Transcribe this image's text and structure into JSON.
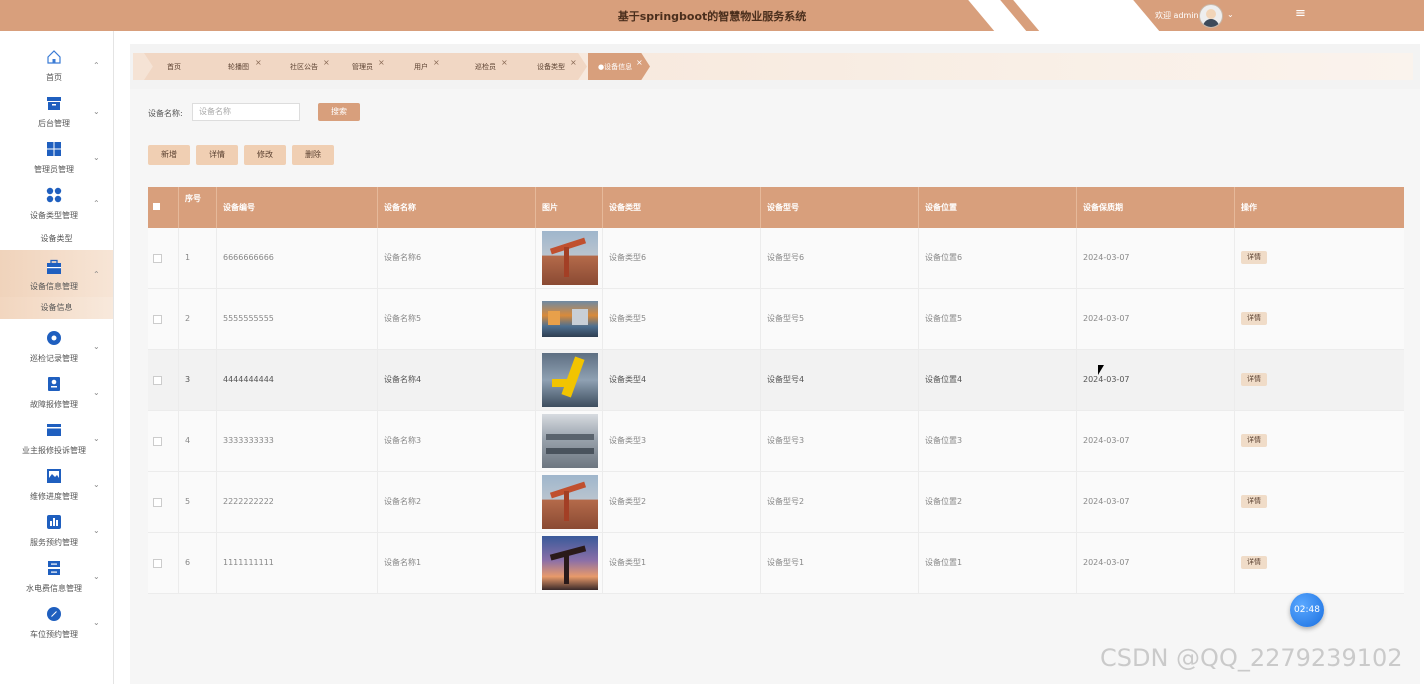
{
  "header": {
    "title": "基于springboot的智慧物业服务系统",
    "welcome": "欢迎 admin",
    "caret": "⌄",
    "menu_icon": "≡"
  },
  "sidebar": {
    "items": [
      {
        "label": "首页",
        "arrow": "⌃",
        "icon": "home-icon"
      },
      {
        "label": "后台管理",
        "arrow": "⌄",
        "icon": "archive-icon"
      },
      {
        "label": "管理员管理",
        "arrow": "⌄",
        "icon": "grid-icon"
      },
      {
        "label": "设备类型管理",
        "arrow": "⌃",
        "icon": "dots-grid-icon"
      },
      {
        "label": "设备信息管理",
        "arrow": "⌃",
        "icon": "briefcase-icon"
      },
      {
        "label": "巡检记录管理",
        "arrow": "⌄",
        "icon": "target-icon"
      },
      {
        "label": "故障报修管理",
        "arrow": "⌄",
        "icon": "badge-icon"
      },
      {
        "label": "业主报修投诉管理",
        "arrow": "⌄",
        "icon": "card-icon"
      },
      {
        "label": "维修进度管理",
        "arrow": "⌄",
        "icon": "image-icon"
      },
      {
        "label": "服务预约管理",
        "arrow": "⌄",
        "icon": "chart-icon"
      },
      {
        "label": "水电费信息管理",
        "arrow": "⌄",
        "icon": "server-icon"
      },
      {
        "label": "车位预约管理",
        "arrow": "⌄",
        "icon": "compass-icon"
      }
    ],
    "subitems": {
      "device_type": "设备类型",
      "device_info": "设备信息"
    }
  },
  "tabs": [
    {
      "label": "首页",
      "closable": false
    },
    {
      "label": "轮播图",
      "closable": true
    },
    {
      "label": "社区公告",
      "closable": true
    },
    {
      "label": "管理员",
      "closable": true
    },
    {
      "label": "用户",
      "closable": true
    },
    {
      "label": "巡检员",
      "closable": true
    },
    {
      "label": "设备类型",
      "closable": true
    },
    {
      "label": "●设备信息",
      "closable": true,
      "active": true
    }
  ],
  "tab_close": "×",
  "search": {
    "label": "设备名称:",
    "placeholder": "设备名称",
    "button": "搜索"
  },
  "actions": {
    "add": "新增",
    "detail": "详情",
    "edit": "修改",
    "delete": "删除"
  },
  "table": {
    "headers": [
      "序号",
      "设备编号",
      "设备名称",
      "图片",
      "设备类型",
      "设备型号",
      "设备位置",
      "设备保质期",
      "操作"
    ],
    "detail_label": "详情",
    "rows": [
      {
        "index": "1",
        "code": "6666666666",
        "name": "设备名称6",
        "type": "设备类型6",
        "model": "设备型号6",
        "location": "设备位置6",
        "date": "2024-03-07",
        "image": "oil-pump-red"
      },
      {
        "index": "2",
        "code": "5555555555",
        "name": "设备名称5",
        "type": "设备类型5",
        "model": "设备型号5",
        "location": "设备位置5",
        "date": "2024-03-07",
        "image": "factory-line"
      },
      {
        "index": "3",
        "code": "4444444444",
        "name": "设备名称4",
        "type": "设备类型4",
        "model": "设备型号4",
        "location": "设备位置4",
        "date": "2024-03-07",
        "image": "yellow-robot"
      },
      {
        "index": "4",
        "code": "3333333333",
        "name": "设备名称3",
        "type": "设备类型3",
        "model": "设备型号3",
        "location": "设备位置3",
        "date": "2024-03-07",
        "image": "workshop"
      },
      {
        "index": "5",
        "code": "2222222222",
        "name": "设备名称2",
        "type": "设备类型2",
        "model": "设备型号2",
        "location": "设备位置2",
        "date": "2024-03-07",
        "image": "oil-pump-red"
      },
      {
        "index": "6",
        "code": "1111111111",
        "name": "设备名称1",
        "type": "设备类型1",
        "model": "设备型号1",
        "location": "设备位置1",
        "date": "2024-03-07",
        "image": "oil-pump-sunset"
      }
    ]
  },
  "timer": "02:48",
  "watermark": "CSDN @QQ_2279239102",
  "colors": {
    "accent": "#d89f7c",
    "accent_light": "#f0cfb3",
    "timer_blue": "#1a6fe0"
  }
}
